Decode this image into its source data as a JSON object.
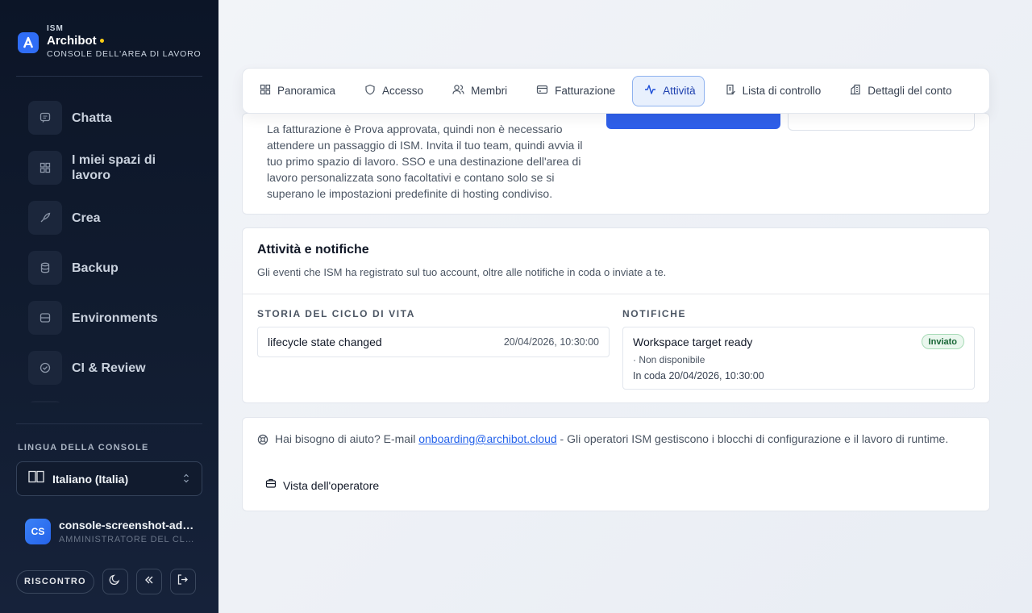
{
  "brand": {
    "org": "ISM",
    "name": "Archibot",
    "subtitle": "CONSOLE DELL'AREA DI LAVORO",
    "accent": "#2f6df6"
  },
  "sidebar": {
    "items": [
      {
        "label": "Chatta",
        "icon": "chat-icon"
      },
      {
        "label": "I miei spazi di lavoro",
        "icon": "grid-icon"
      },
      {
        "label": "Crea",
        "icon": "rocket-icon"
      },
      {
        "label": "Backup",
        "icon": "database-icon"
      },
      {
        "label": "Environments",
        "icon": "server-icon"
      },
      {
        "label": "CI & Review",
        "icon": "check-circle-icon"
      }
    ],
    "language": {
      "title": "LINGUA DELLA CONSOLE",
      "value": "Italiano (Italia)"
    },
    "user": {
      "initials": "CS",
      "name": "console-screenshot-admin",
      "role": "AMMINISTRATORE DEL CLIENTE"
    },
    "feedback_label": "RISCONTRO"
  },
  "tabs": [
    {
      "label": "Panoramica",
      "icon": "grid-icon",
      "active": false
    },
    {
      "label": "Accesso",
      "icon": "shield-icon",
      "active": false
    },
    {
      "label": "Membri",
      "icon": "users-icon",
      "active": false
    },
    {
      "label": "Fatturazione",
      "icon": "credit-card-icon",
      "active": false
    },
    {
      "label": "Attività",
      "icon": "activity-icon",
      "active": true
    },
    {
      "label": "Lista di controllo",
      "icon": "checklist-icon",
      "active": false
    },
    {
      "label": "Dettagli del conto",
      "icon": "building-icon",
      "active": false
    }
  ],
  "billing_card": {
    "text": "La fatturazione è Prova approvata, quindi non è necessario attendere un passaggio di ISM. Invita il tuo team, quindi avvia il tuo primo spazio di lavoro. SSO e una destinazione dell'area di lavoro personalizzata sono facoltativi e contano solo se si superano le impostazioni predefinite di hosting condiviso."
  },
  "activity": {
    "title": "Attività e notifiche",
    "subtitle": "Gli eventi che ISM ha registrato sul tuo account, oltre alle notifiche in coda o inviate a te.",
    "lifecycle": {
      "title": "STORIA DEL CICLO DI VITA",
      "events": [
        {
          "event": "lifecycle state changed",
          "date": "20/04/2026, 10:30:00"
        }
      ]
    },
    "notifications": {
      "title": "NOTIFICHE",
      "items": [
        {
          "title": "Workspace target ready",
          "badge": "Inviato",
          "status": "· Non disponibile",
          "queued": "In coda 20/04/2026, 10:30:00"
        }
      ]
    }
  },
  "help": {
    "prefix": "Hai bisogno di aiuto? E-mail",
    "email": "onboarding@archibot.cloud",
    "suffix": " - Gli operatori ISM gestiscono i blocchi di configurazione e il lavoro di runtime.",
    "operator_label": "Vista dell'operatore"
  }
}
